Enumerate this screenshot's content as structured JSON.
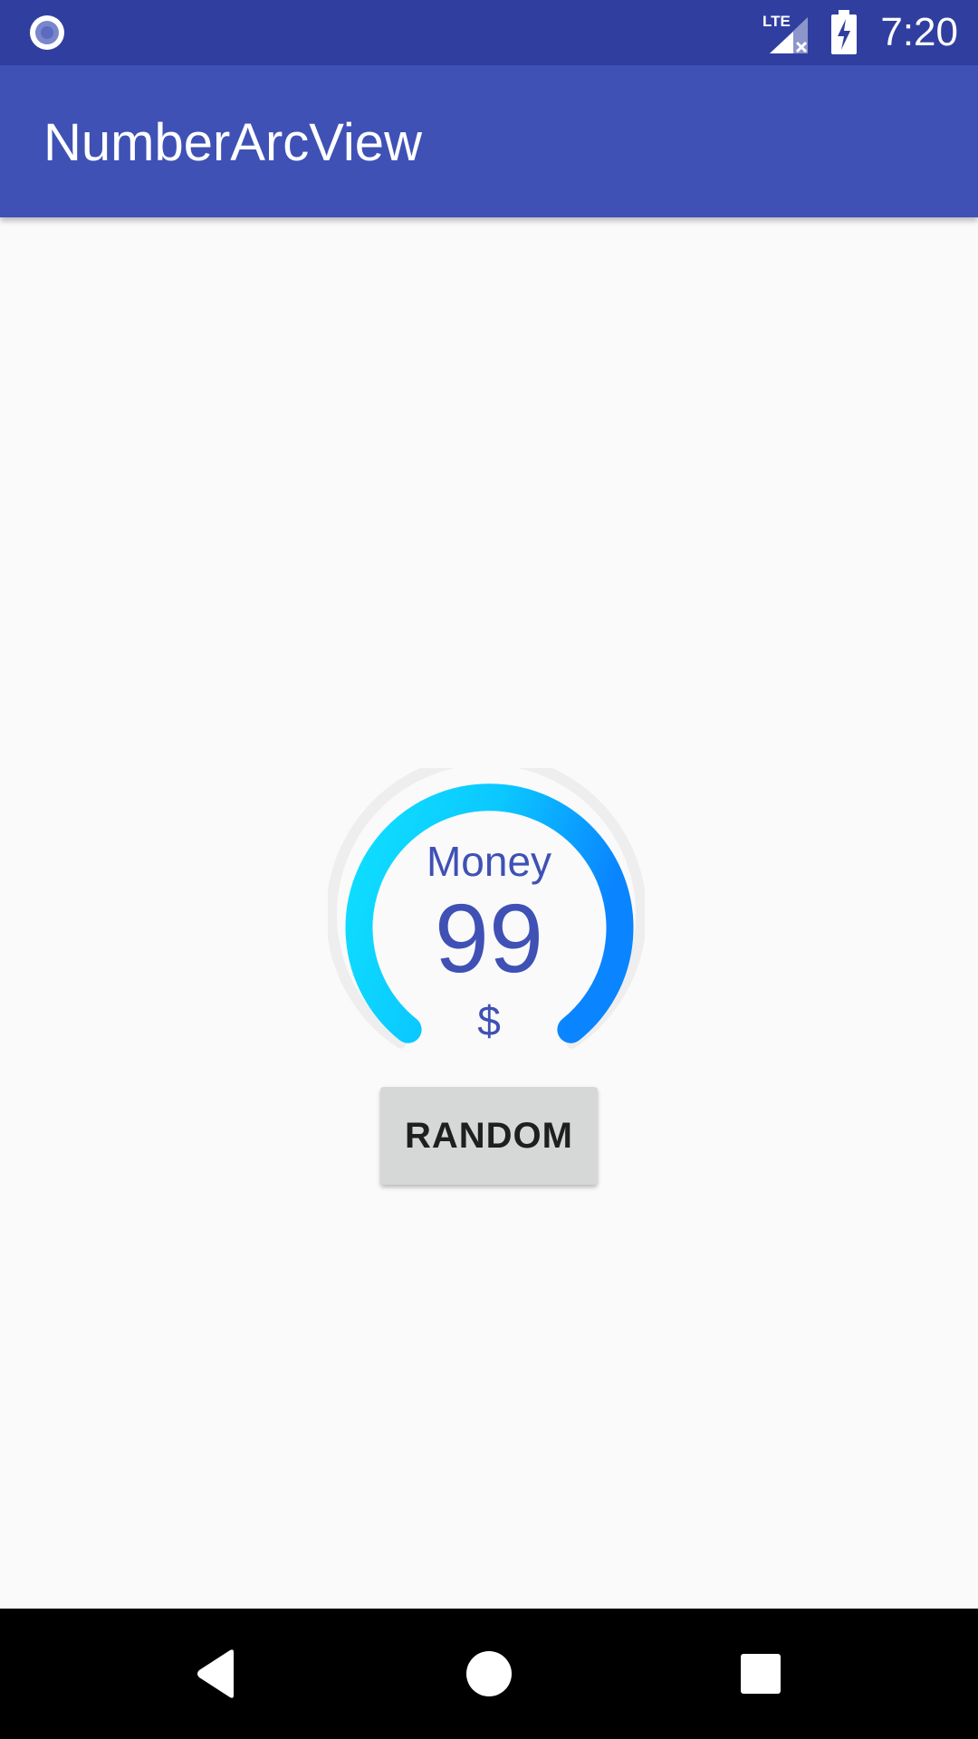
{
  "status_bar": {
    "time": "7:20",
    "network_label": "LTE",
    "icons": [
      "notification-dot-icon",
      "lte-signal-no-data-icon",
      "battery-charging-icon"
    ],
    "background_color": "#303f9f"
  },
  "app_bar": {
    "title": "NumberArcView",
    "background_color": "#3f51b5"
  },
  "gauge": {
    "label": "Money",
    "value": "99",
    "unit": "$",
    "gradient_start_color": "#0fe0ff",
    "gradient_end_color": "#0a84ff",
    "track_color": "#eeeeee",
    "text_color": "#3f51b5"
  },
  "actions": {
    "random_label": "RANDOM"
  },
  "nav_bar": {
    "icons": [
      "back-icon",
      "home-icon",
      "recents-icon"
    ]
  }
}
